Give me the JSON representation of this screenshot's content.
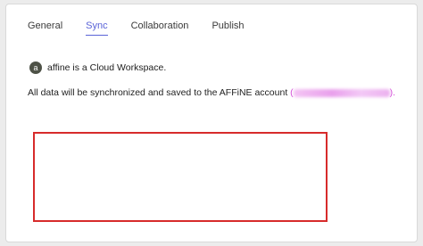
{
  "tabs": [
    {
      "label": "General"
    },
    {
      "label": "Sync"
    },
    {
      "label": "Collaboration"
    },
    {
      "label": "Publish"
    }
  ],
  "active_tab": "Sync",
  "workspace": {
    "avatar_letter": "a",
    "name": "affine",
    "description_suffix": " is a Cloud Workspace."
  },
  "sync": {
    "message_prefix": "All data will be synchronized and saved to the AFFiNE account ",
    "open_paren": "(",
    "close_paren": ").",
    "email_redacted": true
  },
  "colors": {
    "accent": "#5a63d8",
    "email_highlight": "#d24ad6",
    "highlight_box": "#d72b2b"
  }
}
